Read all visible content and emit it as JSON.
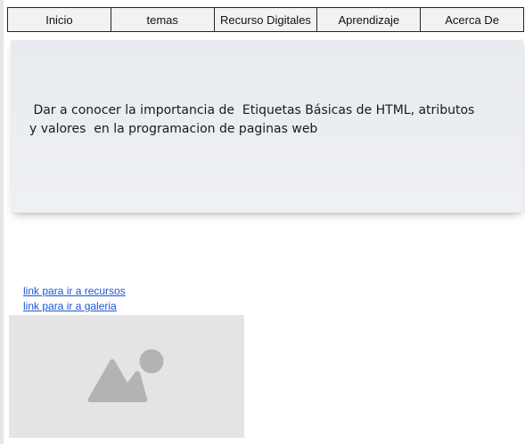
{
  "nav": {
    "items": [
      {
        "label": "Inicio"
      },
      {
        "label": "temas"
      },
      {
        "label": "Recurso Digitales"
      },
      {
        "label": "Aprendizaje"
      },
      {
        "label": "Acerca De"
      }
    ]
  },
  "banner": {
    "line1": " Dar a conocer la importancia de  Etiquetas Básicas de HTML, atributos",
    "line2": "y valores  en la programacion de paginas web"
  },
  "links": {
    "resources": "link para ir a recursos ",
    "gallery": "link para ir a galeria "
  },
  "image": {
    "icon": "image-placeholder-icon"
  },
  "colors": {
    "link": "#1a56d6",
    "banner_bg": "#eceef1",
    "placeholder_bg": "#e4e4e4",
    "placeholder_icon": "#b3b3b3"
  }
}
